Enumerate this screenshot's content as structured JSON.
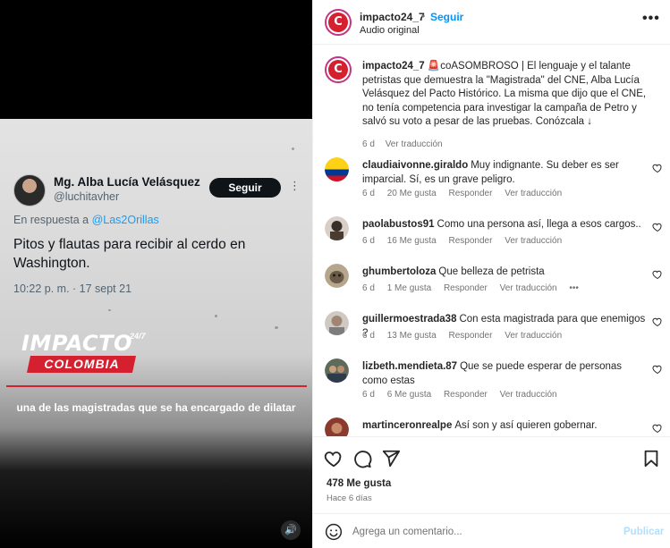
{
  "video": {
    "tweet": {
      "name": "Mg. Alba Lucía Velásquez",
      "handle": "@luchitavher",
      "follow_label": "Seguir",
      "more": "⋮",
      "reply_prefix": "En respuesta a ",
      "reply_mention": "@Las2Orillas",
      "text": "Pitos y flautas para recibir al cerdo en Washington.",
      "time": "10:22 p. m. · 17 sept 21"
    },
    "logo_main": "IMPACTO",
    "logo_sup": "24/7",
    "logo_sub": "COLOMBIA",
    "subtitle": "una de las magistradas que se ha encargado de dilatar",
    "volume_icon": "🔊"
  },
  "header": {
    "avatar_text": "C",
    "username": "impacto24_7",
    "dot": "•",
    "follow": "Seguir",
    "audio": "Audio original",
    "more": "•••"
  },
  "caption": {
    "username": "impacto24_7",
    "text": "🚨coASOMBROSO | El lenguaje y el talante petristas que demuestra la \"Magistrada\" del CNE, Alba Lucía Velásquez del Pacto Histórico. La misma que dijo que el CNE, no tenía competencia para investigar la campaña de Petro y salvó su voto a pesar de las pruebas. Conózcala ↓",
    "age": "6 d",
    "translate": "Ver traducción"
  },
  "comments": [
    {
      "username": "claudiaivonne.giraldo",
      "text": "Muy indignante. Su deber es ser imparcial. Sí, es un grave peligro.",
      "age": "6 d",
      "likes": "20 Me gusta",
      "reply": "Responder",
      "translate": "Ver traducción",
      "more": ""
    },
    {
      "username": "paolabustos91",
      "text": "Como una persona así, llega a esos cargos..",
      "age": "6 d",
      "likes": "16 Me gusta",
      "reply": "Responder",
      "translate": "Ver traducción",
      "more": ""
    },
    {
      "username": "ghumbertoloza",
      "text": "Que belleza de petrista",
      "age": "6 d",
      "likes": "1 Me gusta",
      "reply": "Responder",
      "translate": "Ver traducción",
      "more": "•••"
    },
    {
      "username": "guillermoestrada38",
      "text": "Con esta magistrada para que enemigos ?",
      "age": "6 d",
      "likes": "13 Me gusta",
      "reply": "Responder",
      "translate": "Ver traducción",
      "more": ""
    },
    {
      "username": "lizbeth.mendieta.87",
      "text": "Que se puede esperar de personas como estas",
      "age": "6 d",
      "likes": "6 Me gusta",
      "reply": "Responder",
      "translate": "Ver traducción",
      "more": ""
    },
    {
      "username": "martinceronrealpe",
      "text": "Así son y así quieren gobernar.",
      "age": "",
      "likes": "",
      "reply": "",
      "translate": "",
      "more": ""
    }
  ],
  "actions": {
    "likes": "478 Me gusta",
    "ago": "Hace 6 días"
  },
  "composer": {
    "placeholder": "Agrega un comentario...",
    "publish": "Publicar"
  },
  "colors": {
    "link_blue": "#0095f6",
    "brand_red": "#d4202f",
    "muted": "#737373"
  }
}
